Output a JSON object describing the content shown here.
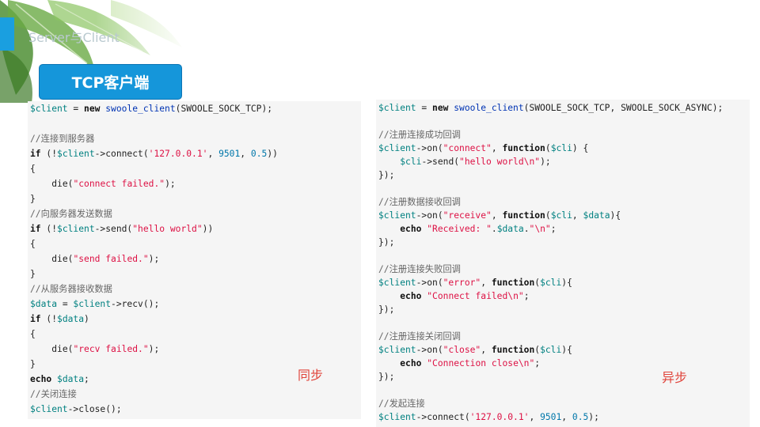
{
  "header": {
    "title": "Server与Client"
  },
  "section_tag": {
    "label": "TCP客户端"
  },
  "sync": {
    "label": "同步",
    "code": [
      "$client = new swoole_client(SWOOLE_SOCK_TCP);",
      "",
      "//连接到服务器",
      "if (!$client->connect('127.0.0.1', 9501, 0.5))",
      "{",
      "    die(\"connect failed.\");",
      "}",
      "//向服务器发送数据",
      "if (!$client->send(\"hello world\"))",
      "{",
      "    die(\"send failed.\");",
      "}",
      "//从服务器接收数据",
      "$data = $client->recv();",
      "if (!$data)",
      "{",
      "    die(\"recv failed.\");",
      "}",
      "echo $data;",
      "//关闭连接",
      "$client->close();"
    ]
  },
  "async": {
    "label": "异步",
    "code": [
      "$client = new swoole_client(SWOOLE_SOCK_TCP, SWOOLE_SOCK_ASYNC);",
      "",
      "//注册连接成功回调",
      "$client->on(\"connect\", function($cli) {",
      "    $cli->send(\"hello world\\n\");",
      "});",
      "",
      "//注册数据接收回调",
      "$client->on(\"receive\", function($cli, $data){",
      "    echo \"Received: \".$data.\"\\n\";",
      "});",
      "",
      "//注册连接失败回调",
      "$client->on(\"error\", function($cli){",
      "    echo \"Connect failed\\n\";",
      "});",
      "",
      "//注册连接关闭回调",
      "$client->on(\"close\", function($cli){",
      "    echo \"Connection close\\n\";",
      "});",
      "",
      "//发起连接",
      "$client->connect('127.0.0.1', 9501, 0.5);"
    ]
  },
  "colors": {
    "accent": "#1596da",
    "variable": "#008080",
    "function": "#0033b3",
    "string": "#dd1144",
    "number": "#0077aa",
    "comment": "#666666",
    "mode_label": "#e0433a"
  }
}
